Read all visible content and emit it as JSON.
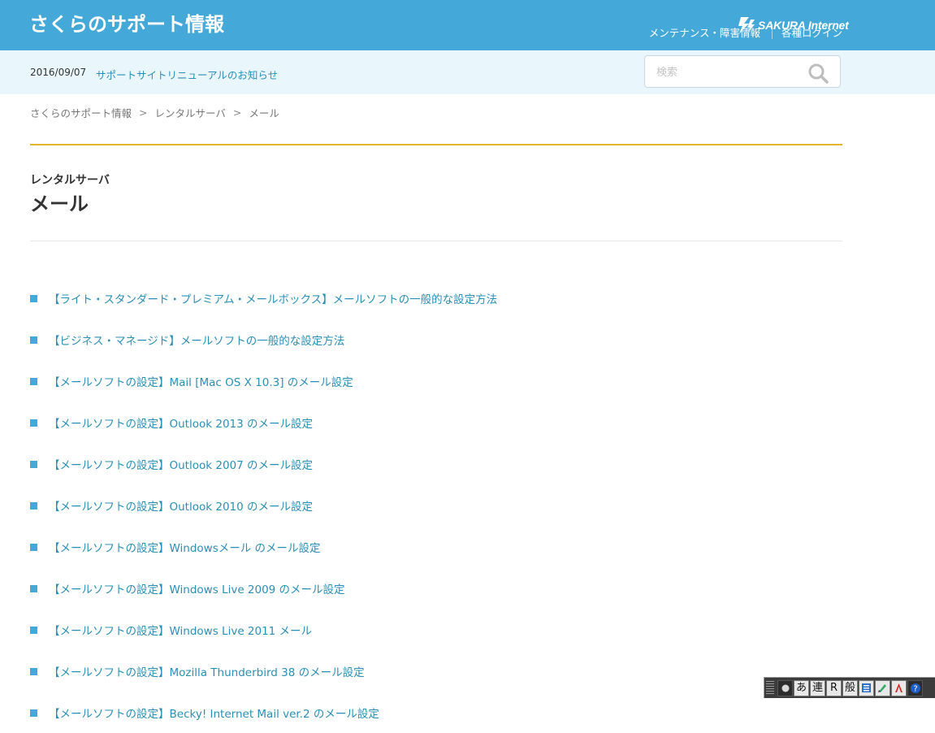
{
  "header": {
    "site_title": "さくらのサポート情報",
    "nav": [
      {
        "label": "メンテナンス・障害情報"
      },
      {
        "label": "各種ログイン"
      }
    ],
    "logo_text": "SAKURA Internet",
    "bg_color": "#44a8d8"
  },
  "notice": {
    "date": "2016/09/07",
    "link": "サポートサイトリニューアルのお知らせ"
  },
  "search": {
    "placeholder": "検索",
    "icon": "search-icon"
  },
  "breadcrumb": [
    {
      "label": "さくらのサポート情報"
    },
    {
      "label": "レンタルサーバ"
    },
    {
      "label": "メール"
    }
  ],
  "breadcrumb_separator": ">",
  "page": {
    "category": "レンタルサーバ",
    "title": "メール"
  },
  "articles": [
    {
      "title": "【ライト・スタンダード・プレミアム・メールボックス】メールソフトの一般的な設定方法"
    },
    {
      "title": "【ビジネス・マネージド】メールソフトの一般的な設定方法"
    },
    {
      "title": "【メールソフトの設定】Mail [Mac OS X 10.3] のメール設定"
    },
    {
      "title": "【メールソフトの設定】Outlook 2013 のメール設定"
    },
    {
      "title": "【メールソフトの設定】Outlook 2007 のメール設定"
    },
    {
      "title": "【メールソフトの設定】Outlook 2010 のメール設定"
    },
    {
      "title": "【メールソフトの設定】Windowsメール のメール設定"
    },
    {
      "title": "【メールソフトの設定】Windows Live 2009 のメール設定"
    },
    {
      "title": "【メールソフトの設定】Windows Live 2011 メール"
    },
    {
      "title": "【メールソフトの設定】Mozilla Thunderbird 38 のメール設定"
    },
    {
      "title": "【メールソフトの設定】Becky! Internet Mail ver.2 のメール設定"
    }
  ],
  "ime_toolbar": {
    "keys": [
      "あ",
      "連",
      "R",
      "般"
    ]
  },
  "colors": {
    "link": "#2a8fb6",
    "accent_rule": "#e2b531",
    "notice_bg": "#e9f6fc"
  }
}
